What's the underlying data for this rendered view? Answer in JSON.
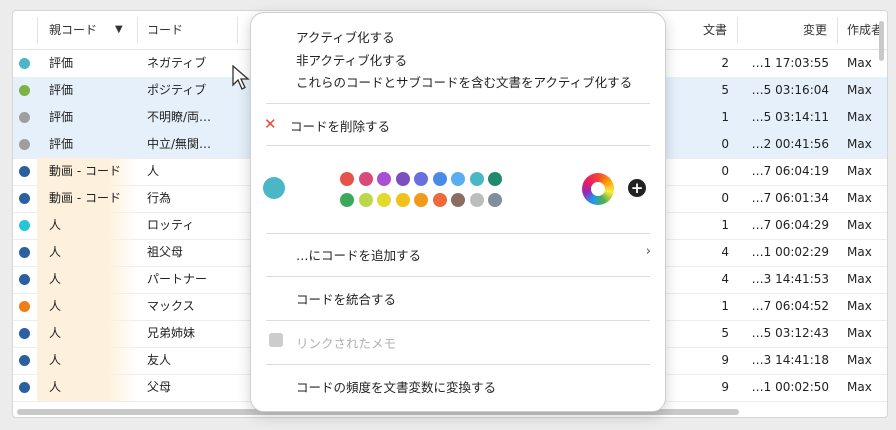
{
  "table": {
    "headers": {
      "parent": "親コード",
      "code": "コード",
      "docs": "文書",
      "changed": "変更",
      "creator": "作成者"
    },
    "rows": [
      {
        "color": "#4ab7c6",
        "parent": "評価",
        "code": "ネガティブ",
        "docs": "2",
        "changed": "…1 17:03:55",
        "creator": "Max",
        "selected": false,
        "parent_bg": "#ffffff"
      },
      {
        "color": "#7cb342",
        "parent": "評価",
        "code": "ポジティブ",
        "docs": "5",
        "changed": "…5 03:16:04",
        "creator": "Max",
        "selected": true,
        "parent_bg": "#e6f0fb"
      },
      {
        "color": "#9e9e9e",
        "parent": "評価",
        "code": "不明瞭/両…",
        "docs": "1",
        "changed": "…5 03:14:11",
        "creator": "Max",
        "selected": true,
        "parent_bg": "#e6f0fb"
      },
      {
        "color": "#9e9e9e",
        "parent": "評価",
        "code": "中立/無関…",
        "docs": "0",
        "changed": "…2 00:41:56",
        "creator": "Max",
        "selected": true,
        "parent_bg": "#e6f0fb"
      },
      {
        "color": "#2a5fa0",
        "parent": "動画 - コード",
        "code": "人",
        "docs": "0",
        "changed": "…7 06:04:19",
        "creator": "Max",
        "selected": false,
        "parent_bg": "#fdf0dc"
      },
      {
        "color": "#2a5fa0",
        "parent": "動画 - コード",
        "code": "行為",
        "docs": "0",
        "changed": "…7 06:01:34",
        "creator": "Max",
        "selected": false,
        "parent_bg": "#fdf0dc"
      },
      {
        "color": "#26c6da",
        "parent": "人",
        "code": "ロッティ",
        "docs": "1",
        "changed": "…7 06:04:29",
        "creator": "Max",
        "selected": false,
        "parent_bg": "#fdf0dc"
      },
      {
        "color": "#2a5fa0",
        "parent": "人",
        "code": "祖父母",
        "docs": "4",
        "changed": "…1 00:02:29",
        "creator": "Max",
        "selected": false,
        "parent_bg": "#fdf0dc"
      },
      {
        "color": "#2a5fa0",
        "parent": "人",
        "code": "パートナー",
        "docs": "4",
        "changed": "…3 14:41:53",
        "creator": "Max",
        "selected": false,
        "parent_bg": "#fdf0dc"
      },
      {
        "color": "#ef7d1a",
        "parent": "人",
        "code": "マックス",
        "docs": "1",
        "changed": "…7 06:04:52",
        "creator": "Max",
        "selected": false,
        "parent_bg": "#fdf0dc"
      },
      {
        "color": "#2a5fa0",
        "parent": "人",
        "code": "兄弟姉妹",
        "docs": "5",
        "changed": "…5 03:12:43",
        "creator": "Max",
        "selected": false,
        "parent_bg": "#fdf0dc"
      },
      {
        "color": "#2a5fa0",
        "parent": "人",
        "code": "友人",
        "docs": "9",
        "changed": "…3 14:41:18",
        "creator": "Max",
        "selected": false,
        "parent_bg": "#fdf0dc"
      },
      {
        "color": "#2a5fa0",
        "parent": "人",
        "code": "父母",
        "docs": "9",
        "changed": "…1 00:02:50",
        "creator": "Max",
        "selected": false,
        "parent_bg": "#fdf0dc"
      }
    ]
  },
  "menu": {
    "activate": "アクティブ化する",
    "deactivate": "非アクティブ化する",
    "activate_docs": "これらのコードとサブコードを含む文書をアクティブ化する",
    "delete": "コードを削除する",
    "add_code_to": "…にコードを追加する",
    "merge": "コードを統合する",
    "linked_memo": "リンクされたメモ",
    "convert_freq": "コードの頻度を文書変数に変換する",
    "current_color": "#4ab7c6",
    "palette": [
      "#e5534b",
      "#d84a7b",
      "#a84fd6",
      "#7c4fbf",
      "#6a6fe0",
      "#4a8be8",
      "#5aaef0",
      "#4ab7c6",
      "#1e8a6e",
      "#3aaa5a",
      "#bcd84a",
      "#e4d82a",
      "#f0c21a",
      "#f29a1a",
      "#ef6a3a",
      "#8b6e62",
      "#bdbdbd",
      "#7f8f9c"
    ]
  }
}
